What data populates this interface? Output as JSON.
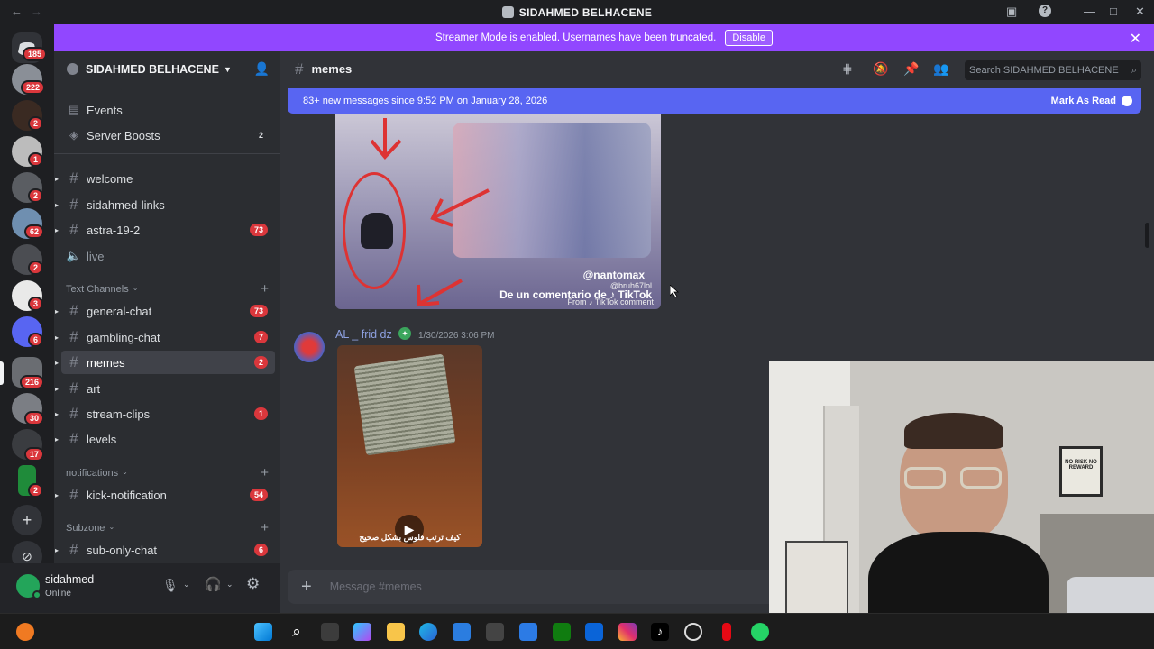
{
  "window": {
    "title": "SIDAHMED BELHACENE"
  },
  "banner": {
    "text": "Streamer Mode is enabled. Usernames have been truncated.",
    "button": "Disable"
  },
  "rail": {
    "badges": [
      "185",
      "222",
      "2",
      "1",
      "2",
      "62",
      "2",
      "3",
      "6",
      "216",
      "30",
      "17",
      "2"
    ]
  },
  "server": {
    "name": "SIDAHMED BELHACENE"
  },
  "sidebar": {
    "top": [
      {
        "label": "Events",
        "count": ""
      },
      {
        "label": "Server Boosts",
        "count": "2"
      }
    ],
    "channels": [
      {
        "label": "welcome",
        "count": ""
      },
      {
        "label": "sidahmed-links",
        "count": ""
      },
      {
        "label": "astra-19-2",
        "count": "73"
      },
      {
        "label": "live",
        "count": ""
      }
    ],
    "categories": {
      "text": "Text Channels",
      "notifications": "notifications",
      "subzone": "Subzone"
    },
    "text_channels": [
      {
        "label": "general-chat",
        "count": "73"
      },
      {
        "label": "gambling-chat",
        "count": "7"
      },
      {
        "label": "memes",
        "count": "2"
      },
      {
        "label": "art",
        "count": ""
      },
      {
        "label": "stream-clips",
        "count": "1"
      },
      {
        "label": "levels",
        "count": ""
      }
    ],
    "notif_channels": [
      {
        "label": "kick-notification",
        "count": "54"
      }
    ],
    "subzone_channels": [
      {
        "label": "sub-only-chat",
        "count": "6"
      }
    ]
  },
  "user": {
    "name": "sidahmed",
    "status": "Online"
  },
  "channel": {
    "name": "memes",
    "search_placeholder": "Search SIDAHMED BELHACENE"
  },
  "newbar": {
    "text": "83+ new messages since 9:52 PM on January 28, 2026",
    "action": "Mark As Read"
  },
  "messages": [
    {
      "watermark1": "@nantomax",
      "watermark2": "@bruh67lol",
      "watermark3": "De un comentario de ♪ TikTok",
      "watermark4": "From ♪ TikTok comment"
    },
    {
      "author": "AL _ frid dz",
      "time": "1/30/2026 3:06 PM",
      "video_caption": "كيف ترتب فلوس بشكل صحيح"
    }
  ],
  "composer": {
    "placeholder": "Message #memes"
  },
  "webcam": {
    "poster": "NO RISK NO REWARD"
  },
  "colors": {
    "accent": "#5865f2",
    "banner": "#9147ff",
    "badge": "#da373c",
    "online": "#23a55a"
  }
}
